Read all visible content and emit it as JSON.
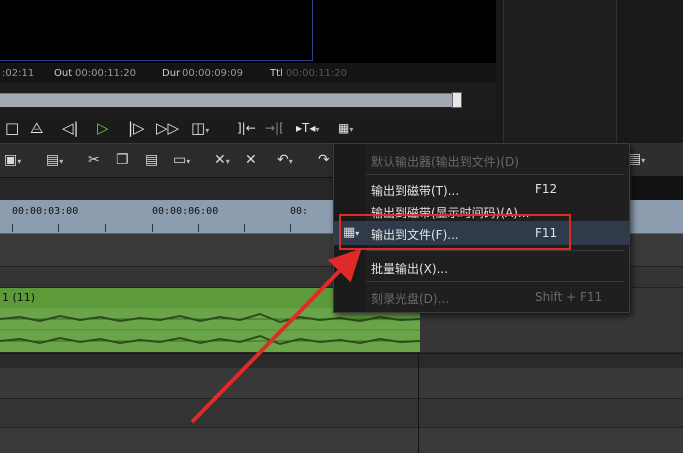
{
  "timecodes": {
    "in_tail": ":02:11",
    "out_label": "Out",
    "out_value": "00:00:11:20",
    "dur_label": "Dur",
    "dur_value": "00:00:09:09",
    "ttl_label": "Ttl",
    "ttl_value": "00:00:11:20"
  },
  "transport": {
    "buttons": [
      "stop-icon",
      "rewind-icon",
      "step-back-icon",
      "play-icon",
      "step-forward-icon",
      "fast-forward-icon",
      "loop-icon",
      "mark-in-icon",
      "mark-out-icon",
      "insert-icon",
      "export-icon"
    ]
  },
  "toolbar": {
    "buttons": [
      "new-icon",
      "save-icon",
      "cut-icon",
      "copy-icon",
      "paste-icon",
      "link-icon",
      "delete-icon",
      "ripple-delete-icon",
      "undo-icon",
      "redo-icon",
      "properties-icon"
    ]
  },
  "ruler": {
    "ticks": [
      "00:00:03:00",
      "00:00:06:00",
      "00:"
    ]
  },
  "clip": {
    "label": "1 (11)"
  },
  "menu": {
    "items": [
      {
        "label": "默认输出器(输出到文件)(D)",
        "shortcut": "",
        "enabled": false
      },
      {
        "label": "输出到磁带(T)...",
        "shortcut": "F12",
        "enabled": true
      },
      {
        "label": "输出到磁带(显示时间码)(A)...",
        "shortcut": "",
        "enabled": true
      },
      {
        "label": "输出到文件(F)...",
        "shortcut": "F11",
        "enabled": true,
        "highlighted": true
      },
      {
        "label": "批量输出(X)...",
        "shortcut": "",
        "enabled": true
      },
      {
        "label": "刻录光盘(D)...",
        "shortcut": "Shift + F11",
        "enabled": false
      }
    ]
  },
  "colors": {
    "annotation": "#e02a2a",
    "play": "#6ecb3a",
    "clip": "#6aa649"
  }
}
